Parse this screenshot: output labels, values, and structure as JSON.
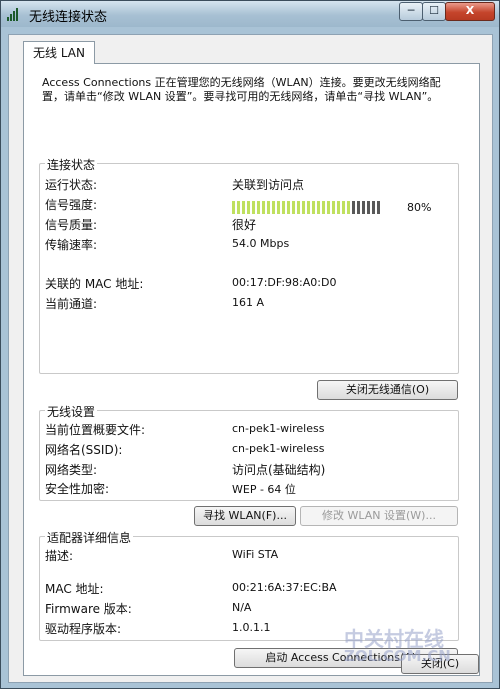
{
  "window": {
    "title": "无线连接状态",
    "min_label": "─",
    "max_label": "☐",
    "close_label": "X"
  },
  "tab": {
    "label": "无线 LAN"
  },
  "intro": "Access Connections 正在管理您的无线网络（WLAN）连接。要更改无线网络配置，请单击“修改 WLAN 设置”。要寻找可用的无线网络，请单击“寻找 WLAN”。",
  "connection": {
    "legend": "连接状态",
    "run_label": "运行状态:",
    "run_value": "关联到访问点",
    "signal_label": "信号强度:",
    "signal_value": "80%",
    "signal_fraction": 0.8,
    "quality_label": "信号质量:",
    "quality_value": "很好",
    "rate_label": "传输速率:",
    "rate_value": "54.0 Mbps",
    "mac_label": "关联的 MAC 地址:",
    "mac_value": "00:17:DF:98:A0:D0",
    "channel_label": "当前通道:",
    "channel_value": "161 A",
    "disable_button": "关闭无线通信(O)"
  },
  "wireless": {
    "legend": "无线设置",
    "profile_label": "当前位置概要文件:",
    "profile_value": "cn-pek1-wireless",
    "ssid_label": "网络名(SSID):",
    "ssid_value": "cn-pek1-wireless",
    "type_label": "网络类型:",
    "type_value": "访问点(基础结构)",
    "security_label": "安全性加密:",
    "security_value": "WEP - 64 位",
    "find_button": "寻找 WLAN(F)...",
    "modify_button": "修改 WLAN 设置(W)..."
  },
  "adapter": {
    "legend": "适配器详细信息",
    "desc_label": "描述:",
    "desc_value": "WiFi STA",
    "mac_label": "MAC 地址:",
    "mac_value": "00:21:6A:37:EC:BA",
    "fw_label": "Firmware 版本:",
    "fw_value": "N/A",
    "driver_label": "驱动程序版本:",
    "driver_value": "1.0.1.1"
  },
  "footer": {
    "launch_button": "启动 Access Connections(A)...",
    "close_button": "关闭(C)"
  },
  "watermark": {
    "line1": "中关村在线",
    "line2": "ZOL.COM.CN"
  }
}
